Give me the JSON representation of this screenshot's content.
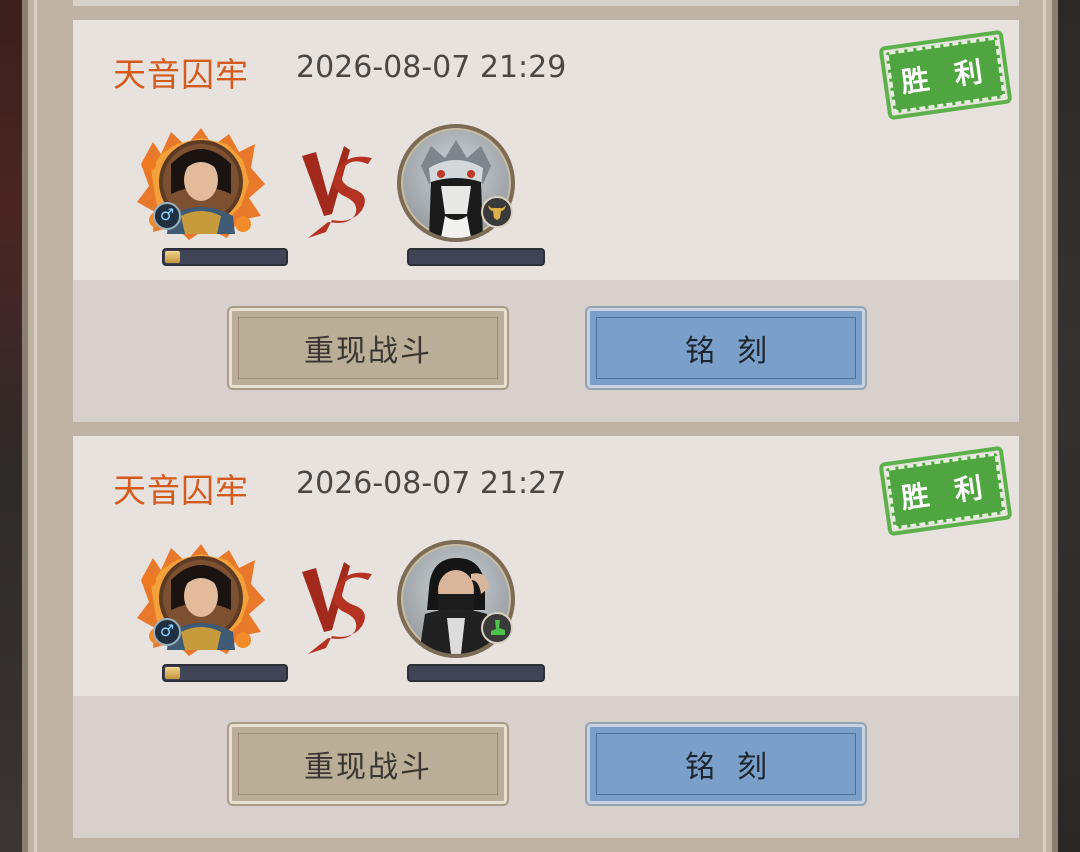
{
  "theme": {
    "location_color": "#d45a1e",
    "victory_color": "#4fa53f",
    "engrave_button_color": "#7aa0c9",
    "replay_button_color": "#bbae98"
  },
  "records": [
    {
      "location": "天音囚牢",
      "timestamp": "2026-08-07 21:29",
      "result": "胜 利",
      "player_avatar": "male-hero-portrait",
      "player_gender": "♂",
      "player_progress": 0.12,
      "opponent_avatar": "dragon-helmet-masked-warrior",
      "opponent_badge_icon": "bull-head-icon",
      "replay_label": "重现战斗",
      "engrave_label": "铭刻"
    },
    {
      "location": "天音囚牢",
      "timestamp": "2026-08-07 21:27",
      "result": "胜 利",
      "player_avatar": "male-hero-portrait",
      "player_gender": "♂",
      "player_progress": 0.12,
      "opponent_avatar": "black-masked-assassin",
      "opponent_badge_icon": "green-boot-icon",
      "replay_label": "重现战斗",
      "engrave_label": "铭刻"
    }
  ]
}
